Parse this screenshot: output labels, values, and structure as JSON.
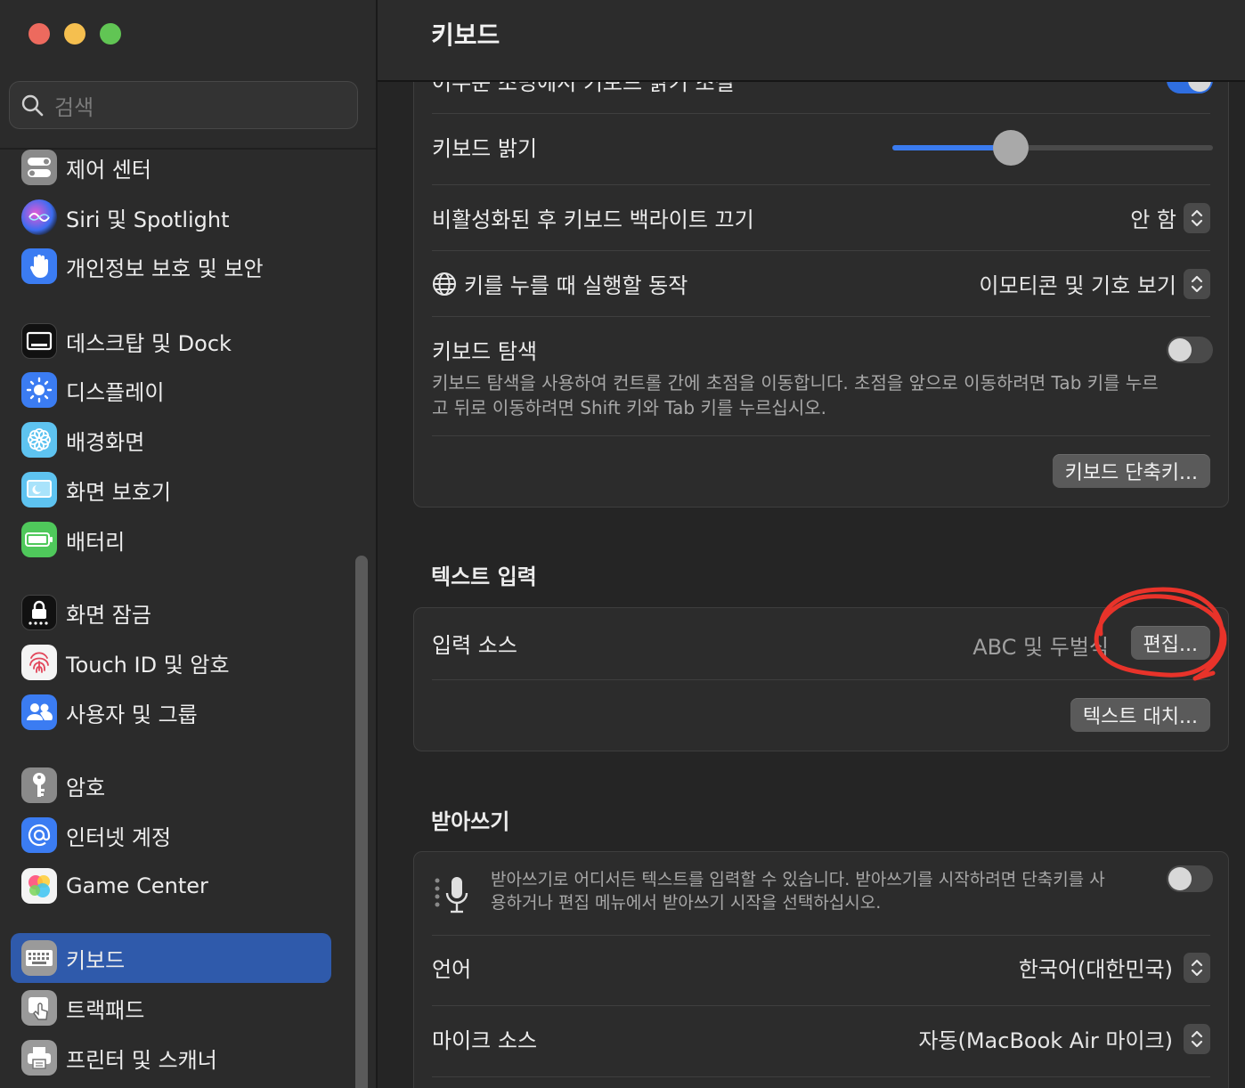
{
  "window": {
    "title": "키보드"
  },
  "search": {
    "placeholder": "검색"
  },
  "sidebar": {
    "items": [
      {
        "label": "제어 센터"
      },
      {
        "label": "Siri 및 Spotlight"
      },
      {
        "label": "개인정보 보호 및 보안"
      },
      {
        "label": "데스크탑 및 Dock"
      },
      {
        "label": "디스플레이"
      },
      {
        "label": "배경화면"
      },
      {
        "label": "화면 보호기"
      },
      {
        "label": "배터리"
      },
      {
        "label": "화면 잠금"
      },
      {
        "label": "Touch ID 및 암호"
      },
      {
        "label": "사용자 및 그룹"
      },
      {
        "label": "암호"
      },
      {
        "label": "인터넷 계정"
      },
      {
        "label": "Game Center"
      },
      {
        "label": "키보드"
      },
      {
        "label": "트랙패드"
      },
      {
        "label": "프린터 및 스캐너"
      }
    ],
    "selected": "키보드"
  },
  "keyboard_panel": {
    "cut_row_label": "어두운 조명에서 키보드 밝기 조절",
    "cut_row_toggle_on": true,
    "brightness_label": "키보드 밝기",
    "brightness_value": 0.37,
    "backlight_label": "비활성화된 후 키보드 백라이트 끄기",
    "backlight_value": "안 함",
    "globe_label": "키를 누를 때 실행할 동작",
    "globe_value": "이모티콘 및 기호 보기",
    "nav_label": "키보드 탐색",
    "nav_desc": "키보드 탐색을 사용하여 컨트롤 간에 초점을 이동합니다. 초점을 앞으로 이동하려면 Tab 키를 누르고 뒤로 이동하려면 Shift 키와 Tab 키를 누르십시오.",
    "nav_toggle_on": false,
    "shortcuts_button": "키보드 단축키..."
  },
  "text_input": {
    "section_title": "텍스트 입력",
    "source_label": "입력 소스",
    "source_value": "ABC 및 두벌식",
    "edit_button": "편집...",
    "replace_button": "텍스트 대치..."
  },
  "dictation": {
    "section_title": "받아쓰기",
    "desc": "받아쓰기로 어디서든 텍스트를 입력할 수 있습니다. 받아쓰기를 시작하려면 단축키를 사용하거나 편집 메뉴에서 받아쓰기 시작을 선택하십시오.",
    "toggle_on": false,
    "language_label": "언어",
    "language_value": "한국어(대한민국)",
    "mic_label": "마이크 소스",
    "mic_value": "자동(MacBook Air 마이크)"
  },
  "colors": {
    "accent": "#2f5aab",
    "toggle_on": "#2f6ee0",
    "annotation": "#e8332a"
  }
}
